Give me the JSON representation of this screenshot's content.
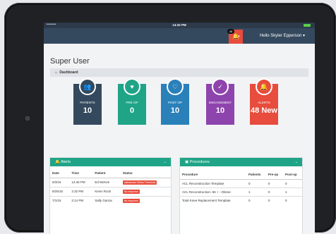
{
  "status_bar": {
    "signal": "••••••",
    "time": "14:32 PM"
  },
  "navbar": {
    "alert_badge": "48",
    "alert_caret": "▾",
    "user_menu": "Hello Skyler Epperson ▾"
  },
  "page": {
    "title": "Super User",
    "breadcrumb": "Dashboard"
  },
  "tiles": [
    {
      "label": "PATIENTS",
      "value": "10",
      "color": "#34495e",
      "icon": "patients-icon"
    },
    {
      "label": "PRE OP",
      "value": "0",
      "color": "#1fa487",
      "icon": "heart-icon"
    },
    {
      "label": "POST OP",
      "value": "10",
      "color": "#2a80b9",
      "icon": "heart-outline-icon"
    },
    {
      "label": "ENGAGEMENT",
      "value": "10",
      "color": "#8e44ad",
      "icon": "check-circle-icon"
    },
    {
      "label": "ALERTS",
      "value": "48 New",
      "color": "#e74c3c",
      "icon": "bell-icon"
    }
  ],
  "alerts_panel": {
    "title": "Alerts",
    "columns": [
      "Date",
      "Time",
      "Patient",
      "Status"
    ],
    "rows": [
      {
        "date": "5/3/15",
        "time": "12:46 PM",
        "patient": "Ed McKee",
        "status": "satisfaction Below Threshold"
      },
      {
        "date": "8/25/15",
        "time": "2:32 PM",
        "patient": "Kevin Rock",
        "status": "No response"
      },
      {
        "date": "7/1/15",
        "time": "2:14 PM",
        "patient": "Sally Garcia",
        "status": "No response"
      }
    ]
  },
  "procedures_panel": {
    "title": "Procedures",
    "columns": [
      "Procedure",
      "Patients",
      "Pre-op",
      "Post-op"
    ],
    "rows": [
      {
        "procedure": "ACL Reconstruction Template",
        "patients": "0",
        "pre_op": "0",
        "post_op": "0"
      },
      {
        "procedure": "ACL Reconstruction- 65 + - Obese",
        "patients": "1",
        "pre_op": "0",
        "post_op": "1"
      },
      {
        "procedure": "Total Knee Replacement Template",
        "patients": "0",
        "pre_op": "0",
        "post_op": "0"
      }
    ]
  },
  "colors": {
    "navbar": "#34495e",
    "panel_header": "#1fa487",
    "alert": "#e74c3c"
  }
}
